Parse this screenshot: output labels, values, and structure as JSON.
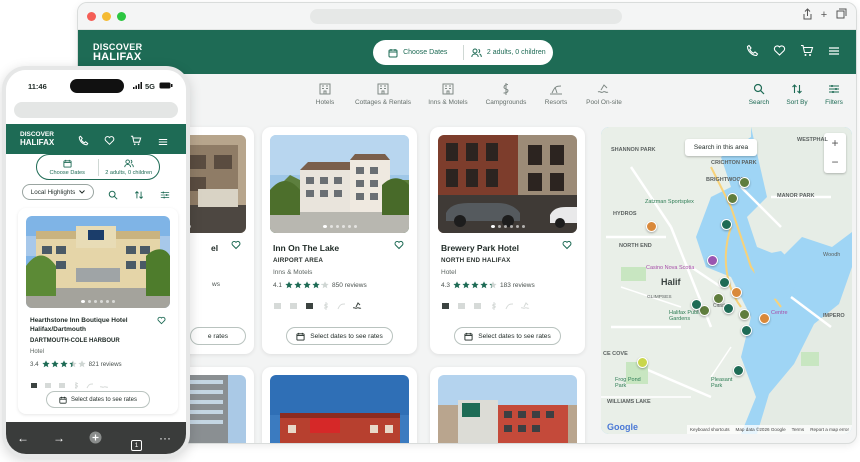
{
  "brand": {
    "line1": "DISCOVER",
    "line2": "HALIFAX",
    "primary": "#1e6b55",
    "star": "#1e6b55"
  },
  "search_pill": {
    "dates": "Choose Dates",
    "guests": "2 adults, 0 children"
  },
  "categories": [
    {
      "label": "Hotels",
      "icon": "hotel-icon"
    },
    {
      "label": "Cottages & Rentals",
      "icon": "cottage-icon"
    },
    {
      "label": "Inns & Motels",
      "icon": "inn-icon"
    },
    {
      "label": "Campgrounds",
      "icon": "campground-icon"
    },
    {
      "label": "Resorts",
      "icon": "resort-icon"
    },
    {
      "label": "Pool On-site",
      "icon": "pool-icon"
    }
  ],
  "tools": {
    "search": "Search",
    "sort": "Sort By",
    "filters": "Filters"
  },
  "listings": [
    {
      "title": "Inn On The Lake",
      "area": "AIRPORT AREA",
      "type": "Inns & Motels",
      "rating": "4.1",
      "rating_value": 4.1,
      "reviews": "850 reviews",
      "cta": "Select dates to see rates"
    },
    {
      "title": "Brewery Park Hotel",
      "area": "NORTH END HALIFAX",
      "type": "Hotel",
      "rating": "4.3",
      "rating_value": 4.3,
      "reviews": "183 reviews",
      "cta": "Select dates to see rates"
    },
    {
      "title_partial": "el",
      "partial_reviews": "ws",
      "cta_partial": "e rates"
    }
  ],
  "map": {
    "search_area": "Search in this area",
    "zoom_in": "+",
    "zoom_out": "−",
    "labels": [
      "SHANNON PARK",
      "CRICHTON PARK",
      "WESTPHAL",
      "BRIGHTWOOD",
      "MANOR PARK",
      "Zatzman Sportsplex",
      "HYDROS",
      "NORTH END",
      "Casino Nova Scotia",
      "Halif",
      "GLIMPSES",
      "Halifax Public Gardens",
      "Citadel",
      "Centre",
      "IMPERO",
      "CE COVE",
      "Frog Pond Park",
      "Pleasant Park",
      "WILLIAMS LAKE",
      "Woodh"
    ],
    "google": "Google",
    "attribution": [
      "Keyboard shortcuts",
      "Map data ©2026 Google",
      "Terms",
      "Report a map error"
    ]
  },
  "phone": {
    "time": "11:46",
    "signal": "5G",
    "filter_label": "Local Highlights",
    "pill_dates": "Choose Dates",
    "pill_guests": "2 adults, 0 children",
    "listing": {
      "title_line1": "Hearthstone Inn Boutique Hotel",
      "title_line2": "Halifax/Dartmouth",
      "area": "DARTMOUTH-COLE HARBOUR",
      "type": "Hotel",
      "rating": "3.4",
      "rating_value": 3.4,
      "reviews": "821 reviews",
      "cta": "Select dates to see rates"
    },
    "tab_count": "1"
  }
}
